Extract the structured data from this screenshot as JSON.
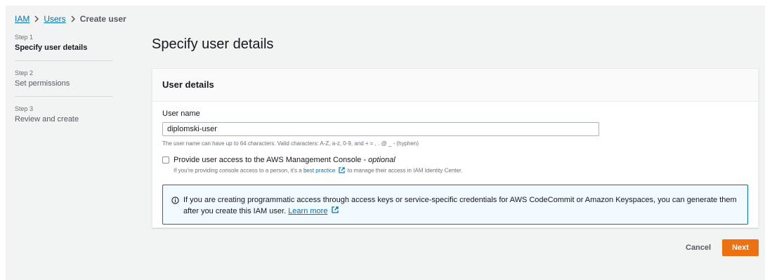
{
  "breadcrumb": {
    "items": [
      "IAM",
      "Users"
    ],
    "current": "Create user"
  },
  "steps": [
    {
      "number": "Step 1",
      "label": "Specify user details"
    },
    {
      "number": "Step 2",
      "label": "Set permissions"
    },
    {
      "number": "Step 3",
      "label": "Review and create"
    }
  ],
  "page_title": "Specify user details",
  "panel": {
    "header": "User details",
    "username_label": "User name",
    "username_value": "diplomski-user",
    "username_hint": "The user name can have up to 64 characters. Valid characters: A-Z, a-z, 0-9, and + = , . @ _ - (hyphen)",
    "console_access": {
      "title": "Provide user access to the AWS Management Console - ",
      "title_optional": "optional",
      "checked": false,
      "desc_prefix": "If you're providing console access to a person, it's a ",
      "desc_link": "best practice",
      "desc_suffix": " to manage their access in IAM Identity Center."
    },
    "info": {
      "text": "If you are creating programmatic access through access keys or service-specific credentials for AWS CodeCommit or Amazon Keyspaces, you can generate them after you create this IAM user. ",
      "link": "Learn more"
    }
  },
  "actions": {
    "cancel": "Cancel",
    "next": "Next"
  },
  "colors": {
    "primary": "#ec7211",
    "link": "#0073bb",
    "info_bg": "#f1faff"
  },
  "icons": {
    "breadcrumb_sep": "chevron-right-icon",
    "external": "external-link-icon",
    "info": "info-icon"
  }
}
